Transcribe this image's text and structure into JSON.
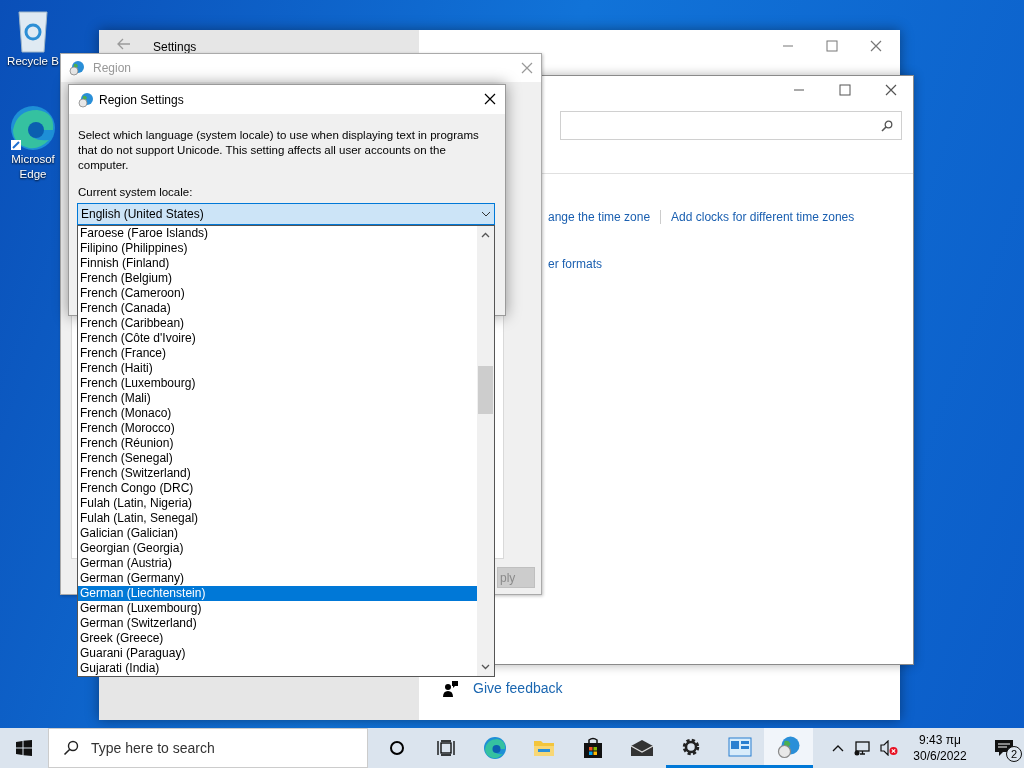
{
  "desktop_icons": [
    {
      "kind": "recycle",
      "label": "Recycle B"
    },
    {
      "kind": "edge",
      "label": "Microsof\nEdge"
    }
  ],
  "settings_window": {
    "title": "Settings",
    "feedback_link": "Give feedback"
  },
  "date_time_window": {
    "links": [
      "ange the time zone",
      "Add clocks for different time zones"
    ],
    "formats_link": "er formats"
  },
  "region_window": {
    "title": "Region",
    "apply_button": "ply",
    "apply_disabled": true
  },
  "region_settings_dialog": {
    "title": "Region Settings",
    "description": "Select which language (system locale) to use when displaying text in programs that do not support Unicode. This setting affects all user accounts on the computer.",
    "locale_label": "Current system locale:",
    "locale_value": "English (United States)",
    "options": [
      {
        "label": "Faroese (Faroe Islands)",
        "selected": false
      },
      {
        "label": "Filipino (Philippines)",
        "selected": false
      },
      {
        "label": "Finnish (Finland)",
        "selected": false
      },
      {
        "label": "French (Belgium)",
        "selected": false
      },
      {
        "label": "French (Cameroon)",
        "selected": false
      },
      {
        "label": "French (Canada)",
        "selected": false
      },
      {
        "label": "French (Caribbean)",
        "selected": false
      },
      {
        "label": "French (Côte d'Ivoire)",
        "selected": false
      },
      {
        "label": "French (France)",
        "selected": false
      },
      {
        "label": "French (Haiti)",
        "selected": false
      },
      {
        "label": "French (Luxembourg)",
        "selected": false
      },
      {
        "label": "French (Mali)",
        "selected": false
      },
      {
        "label": "French (Monaco)",
        "selected": false
      },
      {
        "label": "French (Morocco)",
        "selected": false
      },
      {
        "label": "French (Réunion)",
        "selected": false
      },
      {
        "label": "French (Senegal)",
        "selected": false
      },
      {
        "label": "French (Switzerland)",
        "selected": false
      },
      {
        "label": "French Congo (DRC)",
        "selected": false
      },
      {
        "label": "Fulah (Latin, Nigeria)",
        "selected": false
      },
      {
        "label": "Fulah (Latin, Senegal)",
        "selected": false
      },
      {
        "label": "Galician (Galician)",
        "selected": false
      },
      {
        "label": "Georgian (Georgia)",
        "selected": false
      },
      {
        "label": "German (Austria)",
        "selected": false
      },
      {
        "label": "German (Germany)",
        "selected": false
      },
      {
        "label": "German (Liechtenstein)",
        "selected": true
      },
      {
        "label": "German (Luxembourg)",
        "selected": false
      },
      {
        "label": "German (Switzerland)",
        "selected": false
      },
      {
        "label": "Greek (Greece)",
        "selected": false
      },
      {
        "label": "Guarani (Paraguay)",
        "selected": false
      },
      {
        "label": "Gujarati (India)",
        "selected": false
      }
    ]
  },
  "taskbar": {
    "search_placeholder": "Type here to search",
    "apps": [
      {
        "kind": "cortana",
        "running": false,
        "selected": false
      },
      {
        "kind": "taskview",
        "running": false,
        "selected": false
      },
      {
        "kind": "edge",
        "running": false,
        "selected": false
      },
      {
        "kind": "explorer",
        "running": false,
        "selected": false
      },
      {
        "kind": "store",
        "running": false,
        "selected": false
      },
      {
        "kind": "mail",
        "running": false,
        "selected": false
      },
      {
        "kind": "settings",
        "running": true,
        "selected": false
      },
      {
        "kind": "controlpanel",
        "running": true,
        "selected": false
      },
      {
        "kind": "region",
        "running": true,
        "selected": true
      }
    ],
    "time": "9:43 πμ",
    "date": "30/6/2022",
    "notification_count": "2"
  }
}
